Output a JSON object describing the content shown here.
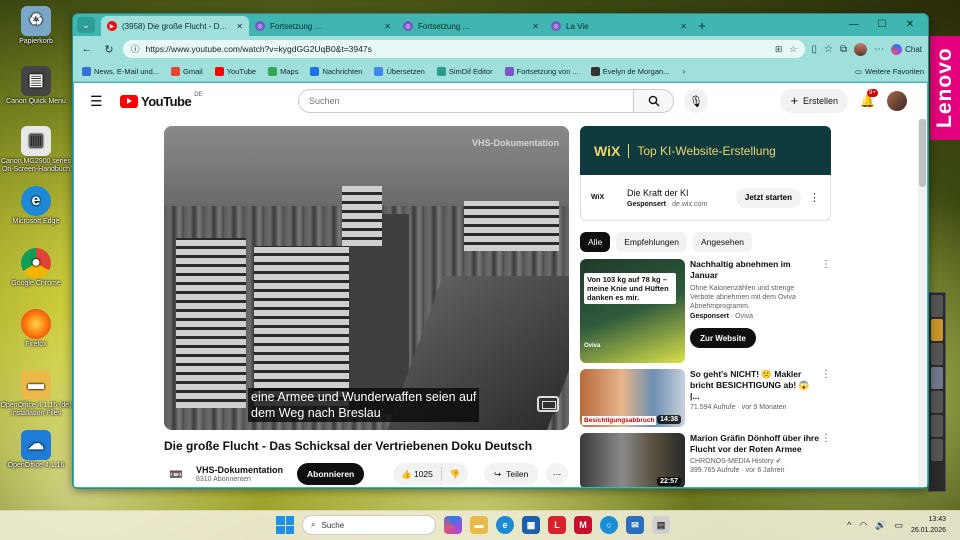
{
  "desktop": {
    "icons": [
      {
        "label": "Papierkorb",
        "icon": "recycle-bin-icon",
        "color": "#7aa6c8"
      },
      {
        "label": "Canon Quick Menu",
        "icon": "printer-icon",
        "color": "#444444"
      },
      {
        "label": "Canon MG2900 series On-Screen-Handbuch",
        "icon": "document-icon",
        "color": "#e8e8e8"
      },
      {
        "label": "Microsoft Edge",
        "icon": "edge-icon",
        "color": "#1e8ad6"
      },
      {
        "label": "Google Chrome",
        "icon": "chrome-icon",
        "color": "#db4437"
      },
      {
        "label": "Firefox",
        "icon": "firefox-icon",
        "color": "#ff6a00"
      },
      {
        "label": "OpenOffice 4.1.16 (de) Installation Files",
        "icon": "folder-icon",
        "color": "#e9b949"
      },
      {
        "label": "OpenOffice 4.1.16",
        "icon": "openoffice-icon",
        "color": "#1e7bd6"
      }
    ],
    "brand_badge": "Lenovo"
  },
  "browser": {
    "tabs": [
      {
        "label": "(3958) Die große Flucht - Das Schick",
        "icon": "youtube-icon",
        "active": true
      },
      {
        "label": "Fortsetzung ...",
        "icon": "globe-icon",
        "active": false
      },
      {
        "label": "Fortsetzung ...",
        "icon": "globe-icon",
        "active": false
      },
      {
        "label": "La Vie",
        "icon": "globe-icon",
        "active": false
      }
    ],
    "url": "https://www.youtube.com/watch?v=kygdGG2UqB0&t=3947s",
    "chat_label": "Chat",
    "bookmarks": [
      {
        "label": "News, E-Mail und...",
        "color": "#3a6fd8"
      },
      {
        "label": "Gmail",
        "color": "#ea4335"
      },
      {
        "label": "YouTube",
        "color": "#ff0000"
      },
      {
        "label": "Maps",
        "color": "#34a853"
      },
      {
        "label": "Nachrichten",
        "color": "#1a73e8"
      },
      {
        "label": "Übersetzen",
        "color": "#4285f4"
      },
      {
        "label": "SimDif Editor",
        "color": "#2b9b8c"
      },
      {
        "label": "Fortsetzung von ...",
        "color": "#7a56c8"
      },
      {
        "label": "Evelyn de Morgan...",
        "color": "#333333"
      }
    ],
    "more_favorites": "Weitere Favoriten"
  },
  "youtube": {
    "logo": "YouTube",
    "country": "DE",
    "search_placeholder": "Suchen",
    "create_label": "Erstellen",
    "notifications": "9+",
    "video": {
      "watermark": "VHS-Dokumentation",
      "subtitle_line1": "eine Armee und Wunderwaffen seien auf",
      "subtitle_line2": "dem Weg nach Breslau",
      "title": "Die große Flucht - Das Schicksal der Vertriebenen Doku Deutsch",
      "channel": "VHS-Dokumentation",
      "subscribers": "8310 Abonnenten",
      "subscribe": "Abonnieren",
      "likes": "1025",
      "share": "Teilen"
    },
    "ad": {
      "banner_brand": "WiX",
      "banner_text": "Top KI-Website-Erstellung",
      "title": "Die Kraft der KI",
      "sponsored": "Gesponsert",
      "domain": "de.wix.com",
      "cta": "Jetzt starten",
      "logo_small": "WiX"
    },
    "chips": [
      "Alle",
      "Empfehlungen",
      "Angesehen"
    ],
    "recommendations": [
      {
        "title": "Nachhaltig abnehmen im Januar",
        "desc": "Ohne Kalorienzählen und strenge Verbote abnehmen mit dem Oviva Abnehmprogramm.",
        "meta_strong": "Gesponsert",
        "meta": "· Oviva",
        "cta": "Zur Website",
        "thumb_text": "Von 103 kg auf 78 kg – meine Knie und Hüften danken es mir.",
        "thumb_small": "Oviva"
      },
      {
        "title": "So geht's NICHT! 🙁 Makler bricht BESICHTIGUNG ab! 😱 |...",
        "meta": "71.594 Aufrufe · vor 9 Monaten",
        "duration": "14:38",
        "thumb_text": "Besichtigungsabbruch"
      },
      {
        "title": "Marion Gräfin Dönhoff über ihre Flucht vor der Roten Armee",
        "channel": "CHRONOS-MEDIA History",
        "meta": "399.765 Aufrufe · vor 6 Jahren",
        "duration": "22:57"
      }
    ]
  },
  "taskbar": {
    "search_placeholder": "Suche",
    "time": "13:43",
    "date": "26.01.2026"
  }
}
